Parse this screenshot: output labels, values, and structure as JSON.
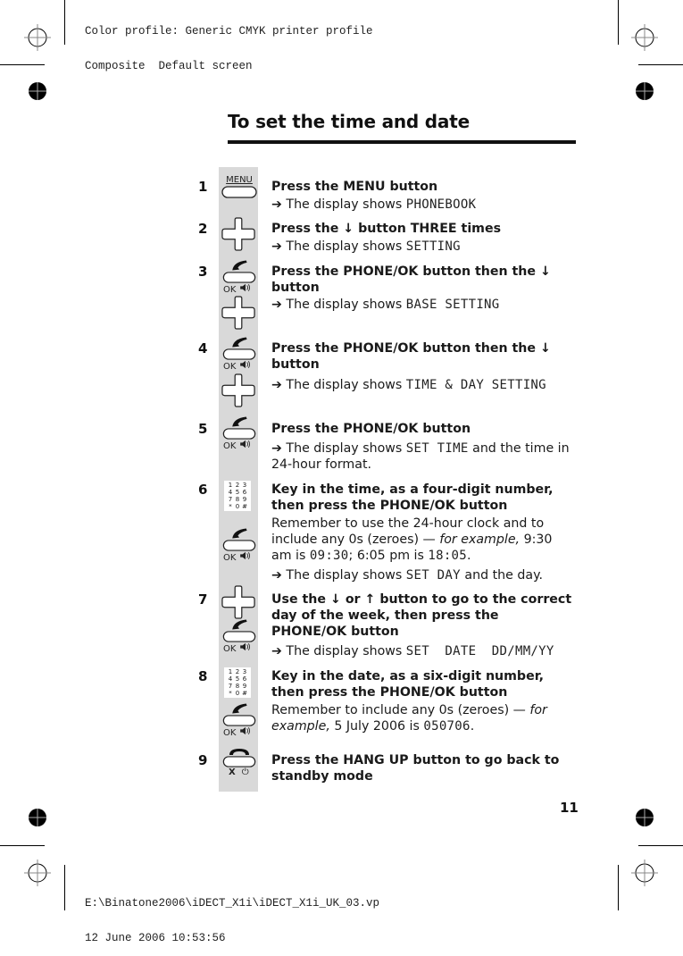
{
  "print_header": {
    "line1": "Color profile: Generic CMYK printer profile",
    "line2": "Composite  Default screen"
  },
  "print_footer": {
    "line1": "E:\\Binatone2006\\iDECT_X1i\\iDECT_X1i_UK_03.vp",
    "line2": "12 June 2006 10:53:56"
  },
  "title": "To set the time and date",
  "page_number": "11",
  "arrow": "➔",
  "icons": {
    "menu_label": "MENU",
    "ok_label": "OK",
    "hangup_x": "X",
    "keypad_keys": [
      "1",
      "2",
      "3",
      "4",
      "5",
      "6",
      "7",
      "8",
      "9",
      "*",
      "0",
      "#"
    ]
  },
  "steps": [
    {
      "num": "1",
      "icons": [
        "menu-button"
      ],
      "instruction": {
        "pre": "Press the ",
        "bold": "MENU",
        "post": " button"
      },
      "result_prefix": " The display shows ",
      "display": "PHONEBOOK"
    },
    {
      "num": "2",
      "icons": [
        "navigation-pad"
      ],
      "instruction": {
        "pre": "Press the ",
        "down": "↓",
        "post": " button THREE times"
      },
      "result_prefix": "The display shows ",
      "display": "SETTING"
    },
    {
      "num": "3",
      "icons": [
        "phone-ok-button",
        "navigation-pad"
      ],
      "instruction": {
        "pre": "Press the ",
        "bold": "PHONE/OK",
        "post": " button then the ",
        "down": "↓",
        "tail": "button"
      },
      "result_prefix": "The display shows ",
      "display": "BASE SETTING"
    },
    {
      "num": "4",
      "icons": [
        "phone-ok-button",
        "navigation-pad"
      ],
      "instruction": {
        "pre": "Press the ",
        "bold": "PHONE/OK",
        "post": " button then the ",
        "down": "↓",
        "tail": "button"
      },
      "result_prefix": "The display shows ",
      "display": "TIME & DAY SETTING"
    },
    {
      "num": "5",
      "icons": [
        "phone-ok-button"
      ],
      "instruction": {
        "pre": "Press the ",
        "bold": "PHONE/OK",
        "post": " button"
      },
      "result_prefix": "The display shows ",
      "display": "SET TIME",
      "result_suffix": " and the time in 24-hour format."
    },
    {
      "num": "6",
      "icons": [
        "keypad",
        "phone-ok-button"
      ],
      "instruction": {
        "pre": "Key in the time, as a four-digit number, then press the ",
        "bold": "PHONE/OK",
        "post": " button"
      },
      "note": {
        "pre": "Remember to use the 24-hour clock and to include any 0s (zeroes) — ",
        "italic": "for example,",
        "mid1": " 9:30 am is ",
        "lcd1": "09:30",
        "mid2": "; 6:05 pm is ",
        "lcd2": "18:05",
        "post": "."
      },
      "result_prefix": "The display shows ",
      "display": "SET DAY",
      "result_suffix": " and the day."
    },
    {
      "num": "7",
      "icons": [
        "navigation-pad",
        "phone-ok-button"
      ],
      "instruction": {
        "pre": "Use the ",
        "down": "↓",
        "mid": " or ",
        "up": "↑",
        "post": " button to go to the correct day of the week, then press the ",
        "bold": "PHONE/OK",
        "tail": " button"
      },
      "result_prefix": "The display shows ",
      "display": "SET  DATE  DD/MM/YY"
    },
    {
      "num": "8",
      "icons": [
        "keypad",
        "phone-ok-button"
      ],
      "instruction": {
        "pre": "Key in the date, as a six-digit number, then press the ",
        "bold": "PHONE/OK",
        "post": " button"
      },
      "note": {
        "pre": "Remember to include any 0s (zeroes) — ",
        "italic": "for example,",
        "mid1": " 5 July 2006 is ",
        "lcd1": "050706",
        "post": "."
      }
    },
    {
      "num": "9",
      "icons": [
        "hang-up-button"
      ],
      "instruction": {
        "pre": "Press the ",
        "bold": "HANG UP",
        "post": " button to go back to standby mode"
      }
    }
  ]
}
